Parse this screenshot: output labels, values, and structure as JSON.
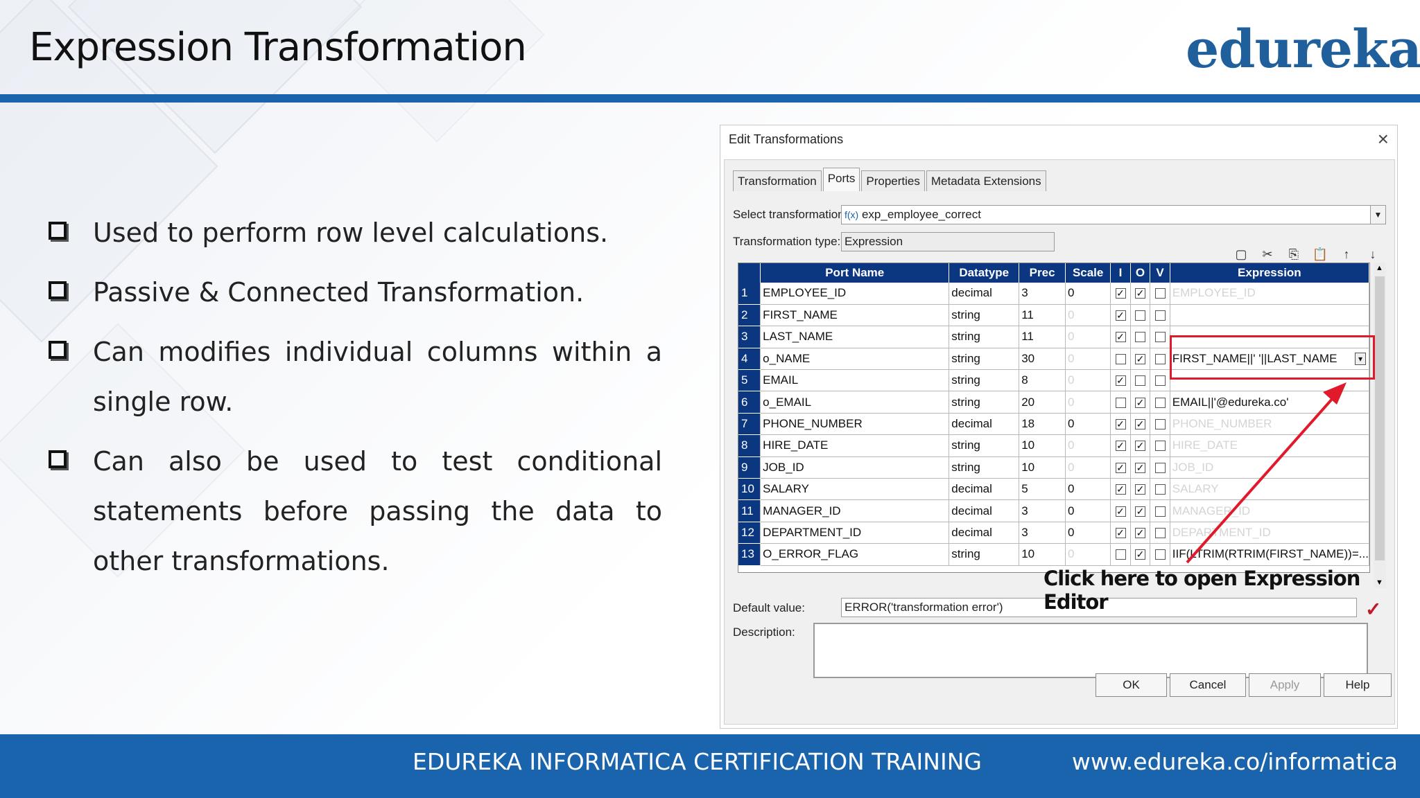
{
  "slide": {
    "title": "Expression Transformation",
    "logo": "edureka!",
    "bullets": [
      "Used to perform row level calculations.",
      "Passive  & Connected Transformation.",
      "Can modifies individual columns within a single row.",
      "Can also be used to test conditional statements before passing the data to other transformations."
    ],
    "footer_left": "EDUREKA INFORMATICA CERTIFICATION TRAINING",
    "footer_right": "www.edureka.co/informatica"
  },
  "dialog": {
    "title": "Edit Transformations",
    "close": "×",
    "tabs": [
      "Transformation",
      "Ports",
      "Properties",
      "Metadata Extensions"
    ],
    "active_tab": "Ports",
    "select_label": "Select transformation:",
    "select_value": "exp_employee_correct",
    "select_icon": "f(x)",
    "type_label": "Transformation type:",
    "type_value": "Expression",
    "toolbar_icons": [
      "new-port-icon",
      "cut-icon",
      "copy-icon",
      "paste-icon",
      "move-up-icon",
      "move-down-icon"
    ],
    "toolbar_glyphs": [
      "▢",
      "✂",
      "⎘",
      "📋",
      "↑",
      "↓"
    ],
    "columns": [
      "Port Name",
      "Datatype",
      "Prec",
      "Scale",
      "I",
      "O",
      "V",
      "Expression"
    ],
    "rows": [
      {
        "n": "1",
        "name": "EMPLOYEE_ID",
        "type": "decimal",
        "prec": "3",
        "scale": "0",
        "i": true,
        "o": true,
        "v": false,
        "expr": "EMPLOYEE_ID",
        "expr_faint": true
      },
      {
        "n": "2",
        "name": "FIRST_NAME",
        "type": "string",
        "prec": "11",
        "scale": "0",
        "scale_faint": true,
        "i": true,
        "o": false,
        "v": false,
        "expr": "",
        "expr_faint": true
      },
      {
        "n": "3",
        "name": "LAST_NAME",
        "type": "string",
        "prec": "11",
        "scale": "0",
        "scale_faint": true,
        "i": true,
        "o": false,
        "v": false,
        "expr": "",
        "expr_faint": true
      },
      {
        "n": "4",
        "name": "o_NAME",
        "type": "string",
        "prec": "30",
        "scale": "0",
        "scale_faint": true,
        "i": false,
        "o": true,
        "v": false,
        "expr": "FIRST_NAME||' '||LAST_NAME",
        "expr_faint": false
      },
      {
        "n": "5",
        "name": "EMAIL",
        "type": "string",
        "prec": "8",
        "scale": "0",
        "scale_faint": true,
        "i": true,
        "o": false,
        "v": false,
        "expr": "",
        "expr_faint": true
      },
      {
        "n": "6",
        "name": "o_EMAIL",
        "type": "string",
        "prec": "20",
        "scale": "0",
        "scale_faint": true,
        "i": false,
        "o": true,
        "v": false,
        "expr": "EMAIL||'@edureka.co'",
        "expr_faint": false
      },
      {
        "n": "7",
        "name": "PHONE_NUMBER",
        "type": "decimal",
        "prec": "18",
        "scale": "0",
        "i": true,
        "o": true,
        "v": false,
        "expr": "PHONE_NUMBER",
        "expr_faint": true
      },
      {
        "n": "8",
        "name": "HIRE_DATE",
        "type": "string",
        "prec": "10",
        "scale": "0",
        "scale_faint": true,
        "i": true,
        "o": true,
        "v": false,
        "expr": "HIRE_DATE",
        "expr_faint": true
      },
      {
        "n": "9",
        "name": "JOB_ID",
        "type": "string",
        "prec": "10",
        "scale": "0",
        "scale_faint": true,
        "i": true,
        "o": true,
        "v": false,
        "expr": "JOB_ID",
        "expr_faint": true
      },
      {
        "n": "10",
        "name": "SALARY",
        "type": "decimal",
        "prec": "5",
        "scale": "0",
        "i": true,
        "o": true,
        "v": false,
        "expr": "SALARY",
        "expr_faint": true
      },
      {
        "n": "11",
        "name": "MANAGER_ID",
        "type": "decimal",
        "prec": "3",
        "scale": "0",
        "i": true,
        "o": true,
        "v": false,
        "expr": "MANAGER_ID",
        "expr_faint": true
      },
      {
        "n": "12",
        "name": "DEPARTMENT_ID",
        "type": "decimal",
        "prec": "3",
        "scale": "0",
        "i": true,
        "o": true,
        "v": false,
        "expr": "DEPARTMENT_ID",
        "expr_faint": true
      },
      {
        "n": "13",
        "name": "O_ERROR_FLAG",
        "type": "string",
        "prec": "10",
        "scale": "0",
        "scale_faint": true,
        "i": false,
        "o": true,
        "v": false,
        "expr": "IIF(LTRIM(RTRIM(FIRST_NAME))=...",
        "expr_faint": false
      }
    ],
    "expr_button": "▾",
    "callout": "Click here to open Expression Editor",
    "default_label": "Default value:",
    "default_value": "ERROR('transformation error')",
    "validate_mark": "✓",
    "description_label": "Description:",
    "description_value": "",
    "buttons": {
      "ok": "OK",
      "cancel": "Cancel",
      "apply": "Apply",
      "help": "Help"
    }
  },
  "colors": {
    "brand_blue": "#1a63ad",
    "grid_header": "#0b3680",
    "highlight_red": "#e0192b"
  }
}
